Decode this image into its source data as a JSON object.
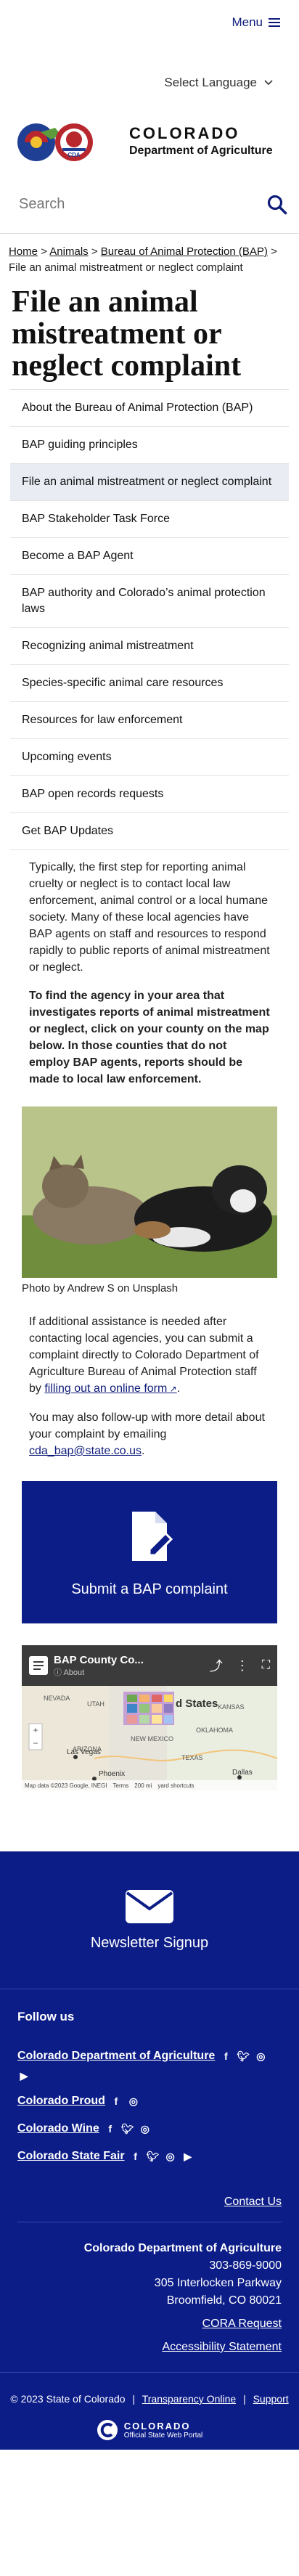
{
  "header": {
    "menu_label": "Menu",
    "language_label": "Select Language",
    "logo_title": "COLORADO",
    "logo_subtitle": "Department of Agriculture",
    "logo_badge": "CDA"
  },
  "search": {
    "placeholder": "Search"
  },
  "breadcrumb": {
    "items": [
      "Home",
      "Animals",
      "Bureau of Animal Protection (BAP)"
    ],
    "current": "File an animal mistreatment or neglect complaint",
    "separator": ">"
  },
  "page_title": "File an animal mistreatment or neglect complaint",
  "subnav": [
    "About the Bureau of Animal Protection (BAP)",
    "BAP guiding principles",
    "File an animal mistreatment or neglect complaint",
    "BAP Stakeholder Task Force",
    "Become a BAP Agent",
    "BAP authority and Colorado’s animal protection laws",
    "Recognizing animal mistreatment",
    "Species-specific animal care resources",
    "Resources for law enforcement",
    "Upcoming events",
    "BAP open records requests",
    "Get BAP Updates"
  ],
  "body": {
    "para1": "Typically, the first step for reporting animal cruelty or neglect is to contact local law enforcement, animal control or a local humane society. Many of these local agencies have BAP agents on staff and resources to respond rapidly to public reports of animal mistreatment or neglect.",
    "para2": "To find the agency in your area that investigates reports of animal mistreatment or neglect, click on your county on the map below. In those counties that do not employ BAP agents, reports should be made to local law enforcement.",
    "photo_caption": "Photo by Andrew S on Unsplash",
    "para3_before": "If additional assistance is needed after contacting local agencies, you can submit a complaint directly to Colorado Department of Agriculture Bureau of Animal Protection staff by ",
    "para3_link": "filling out an online form",
    "para3_after": ".",
    "para4_before": "You may also follow-up with more detail about your complaint by emailing ",
    "para4_email": "cda_bap@state.co.us",
    "para4_after": "."
  },
  "cta": {
    "label": "Submit a BAP complaint",
    "icon": "file-edit-icon"
  },
  "map": {
    "title": "BAP County Co...",
    "about": "About",
    "states": [
      "NEVADA",
      "UTAH",
      "KANSAS",
      "ARIZONA",
      "NEW MEXICO",
      "OKLAHOMA",
      "TEXAS"
    ],
    "country_label": "d States",
    "cities": [
      "Las Vegas",
      "Phoenix",
      "Dallas"
    ],
    "attribution": "Map data ©2023 Google, INEGI",
    "terms": "Terms",
    "scale": "200 mi",
    "shortcuts": "yard shortcuts"
  },
  "footer": {
    "newsletter_label": "Newsletter Signup",
    "follow_heading": "Follow us",
    "social": [
      {
        "name": "Colorado Department of Agriculture",
        "icons": [
          "facebook-icon",
          "twitter-icon",
          "instagram-icon",
          "youtube-icon"
        ]
      },
      {
        "name": "Colorado Proud",
        "icons": [
          "facebook-icon",
          "instagram-icon"
        ]
      },
      {
        "name": "Colorado Wine",
        "icons": [
          "facebook-icon",
          "twitter-icon",
          "instagram-icon"
        ]
      },
      {
        "name": "Colorado State Fair",
        "icons": [
          "facebook-icon",
          "twitter-icon",
          "instagram-icon",
          "youtube-icon"
        ]
      }
    ],
    "contact_us": "Contact Us",
    "org_name": "Colorado Department of Agriculture",
    "phone": "303-869-9000",
    "address1": "305 Interlocken Parkway",
    "address2": "Broomfield, CO 80021",
    "cora_link": "CORA Request",
    "accessibility_link": "Accessibility Statement"
  },
  "bottom_bar": {
    "copyright": "© 2023 State of Colorado",
    "links": [
      "Transparency Online",
      "Support"
    ],
    "state_logo_title": "COLORADO",
    "state_logo_subtitle": "Official State Web Portal"
  },
  "colors": {
    "brand_navy": "#0c1d88",
    "link": "#0f1d7a",
    "active_nav_bg": "#e9ecf3"
  }
}
